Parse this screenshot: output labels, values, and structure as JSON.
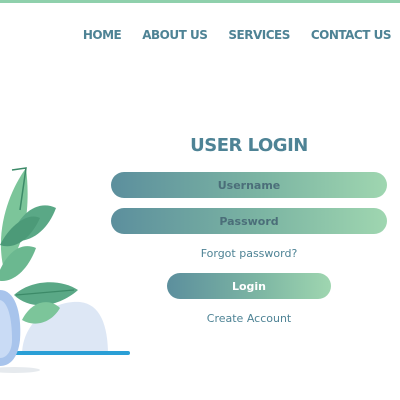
{
  "nav": {
    "items": [
      {
        "label": "HOME"
      },
      {
        "label": "ABOUT US"
      },
      {
        "label": "SERVICES"
      },
      {
        "label": "CONTACT US"
      }
    ]
  },
  "login": {
    "title": "USER LOGIN",
    "username_placeholder": "Username",
    "password_placeholder": "Password",
    "forgot_label": "Forgot password?",
    "login_label": "Login",
    "create_account_label": "Create Account"
  },
  "colors": {
    "text_accent": "#4e8395",
    "gradient_start": "#5c8f9d",
    "gradient_end": "#9fd6b0",
    "top_border": "#8fd0ac",
    "illustration_line": "#2a9fd6"
  },
  "illustration": {
    "icon": "potted-plant-icon"
  }
}
